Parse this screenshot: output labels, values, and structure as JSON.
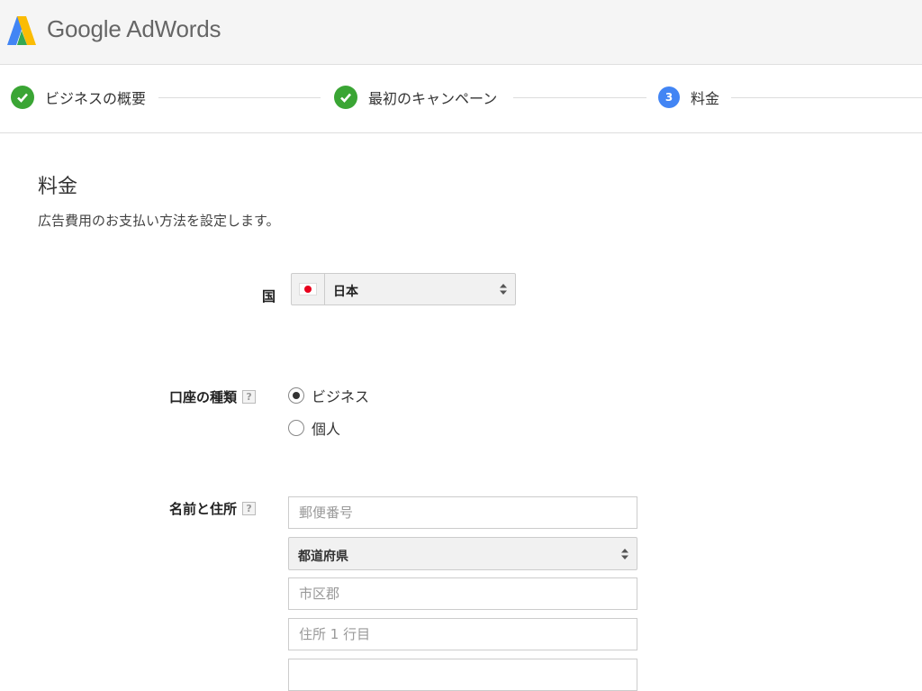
{
  "header": {
    "brand": "Google AdWords"
  },
  "steps": [
    {
      "label": "ビジネスの概要",
      "status": "done"
    },
    {
      "label": "最初のキャンペーン",
      "status": "done"
    },
    {
      "label": "料金",
      "number": "3",
      "status": "current"
    }
  ],
  "page": {
    "title": "料金",
    "subtitle": "広告費用のお支払い方法を設定します。"
  },
  "country": {
    "label": "国",
    "value": "日本"
  },
  "account_type": {
    "label": "口座の種類",
    "help": "?",
    "options": [
      {
        "label": "ビジネス",
        "checked": true
      },
      {
        "label": "個人",
        "checked": false
      }
    ]
  },
  "name_address": {
    "label": "名前と住所",
    "help": "?",
    "postal_placeholder": "郵便番号",
    "prefecture_value": "都道府県",
    "city_placeholder": "市区郡",
    "address1_placeholder": "住所 1 行目"
  },
  "colors": {
    "check_green": "#3aa534",
    "step_blue": "#4285f4"
  }
}
